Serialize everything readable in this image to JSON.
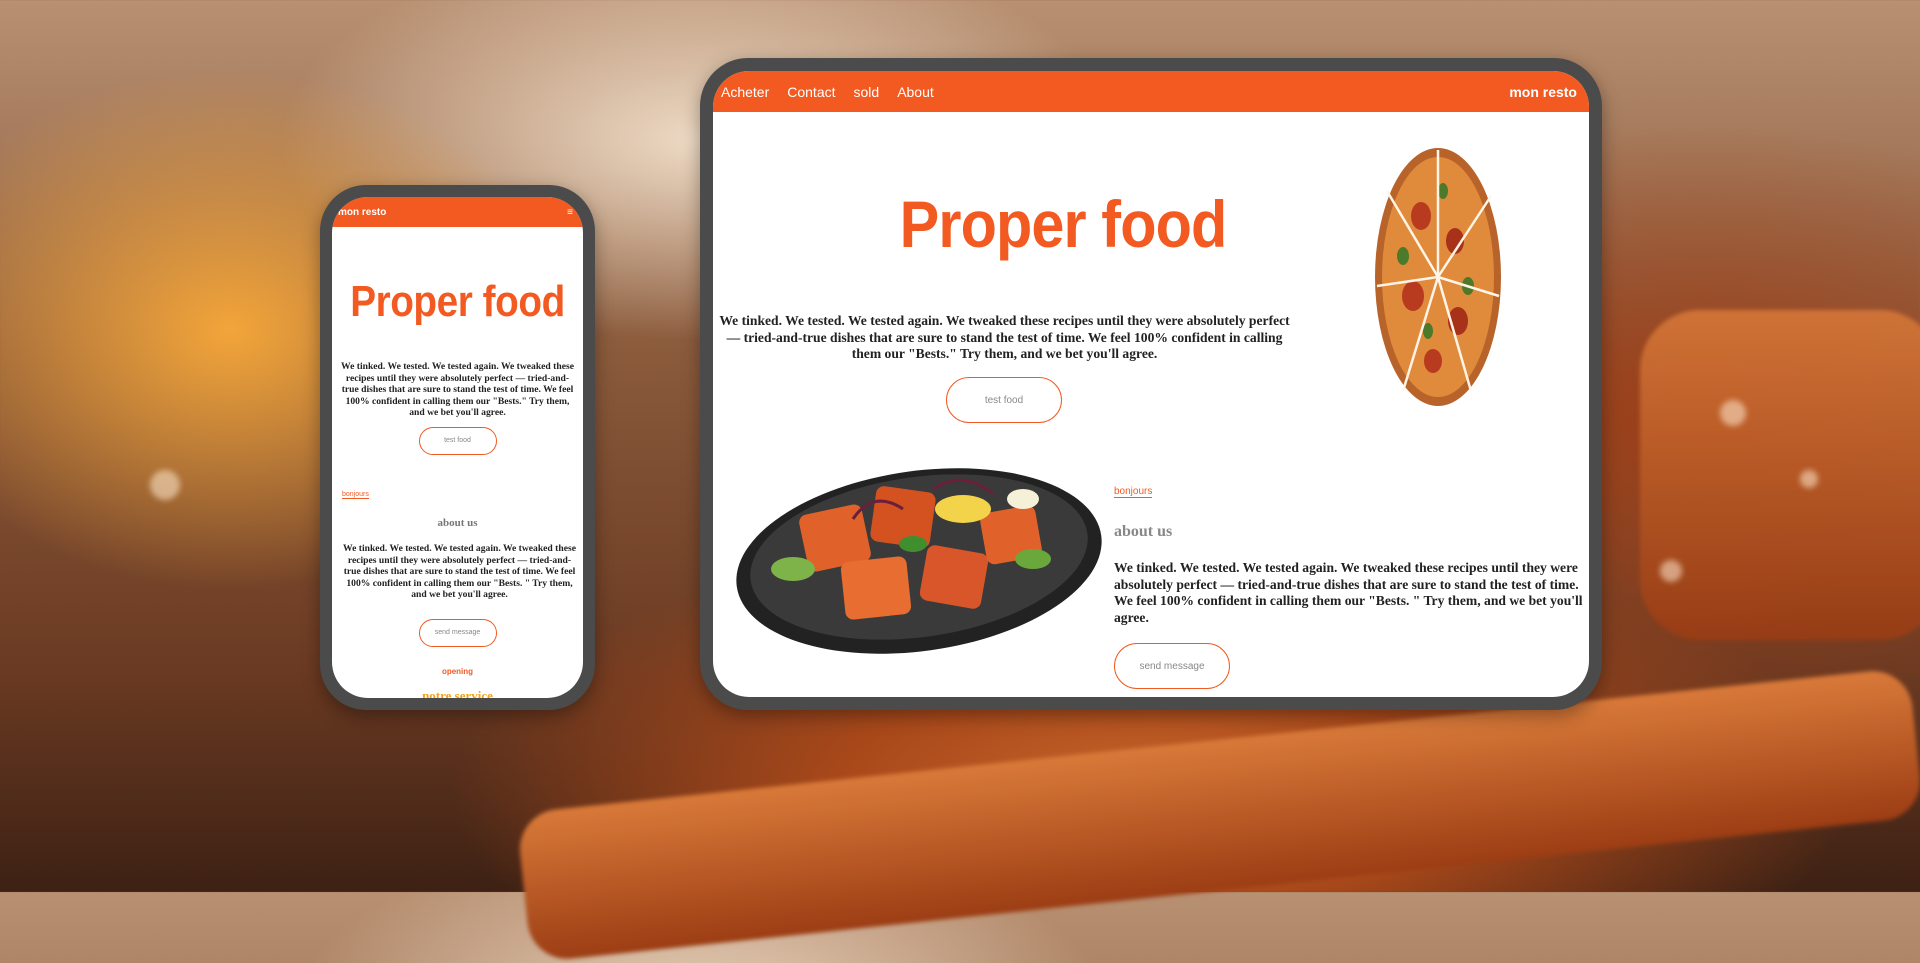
{
  "tablet": {
    "nav": {
      "links": [
        "Acheter",
        "Contact",
        "sold",
        "About"
      ],
      "brand": "mon resto"
    },
    "hero": {
      "title": "Proper food",
      "text": "We tinked. We tested. We tested again. We tweaked these recipes until they were absolutely perfect — tried-and-true dishes that are sure to stand the test of time. We feel 100% confident in calling them our \"Bests.\" Try them, and we bet you'll agree.",
      "button": "test food"
    },
    "about": {
      "eyebrow": "bonjours",
      "heading": "about us",
      "text": "We tinked. We tested. We tested again. We tweaked these recipes until they were absolutely perfect — tried-and-true dishes that are sure to stand the test of time. We feel 100% confident in calling them our \"Bests. \" Try them, and we bet you'll agree.",
      "button": "send message"
    }
  },
  "phone": {
    "nav": {
      "brand": "mon resto",
      "menu_icon": "≡"
    },
    "hero": {
      "title": "Proper food",
      "text": "We tinked. We tested. We tested again. We tweaked these recipes until they were absolutely perfect — tried-and-true dishes that are sure to stand the test of time. We feel 100% confident in calling them our \"Bests.\" Try them, and we bet you'll agree.",
      "button": "test food"
    },
    "about": {
      "eyebrow": "bonjours",
      "heading": "about us",
      "text": "We tinked. We tested. We tested again. We tweaked these recipes until they were absolutely perfect — tried-and-true dishes that are sure to stand the test of time. We feel 100% confident in calling them our \"Bests. \" Try them, and we bet you'll agree.",
      "button": "send message"
    },
    "service": {
      "eyebrow": "opening",
      "heading": "notre service"
    }
  },
  "colors": {
    "accent": "#f25a21",
    "frame": "#4b4b4b",
    "service_heading": "#f2a21a"
  }
}
